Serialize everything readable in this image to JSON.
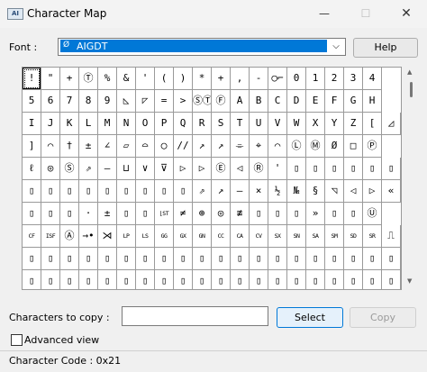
{
  "window": {
    "title": "Character Map",
    "icon": "character-map-app-icon",
    "app_icon_text": "AI",
    "minimize_glyph": "—",
    "maximize_glyph": "☐",
    "close_glyph": "✕"
  },
  "font": {
    "label": "Font :",
    "selected": "AIGDT",
    "icon_glyph": "Ø",
    "dropdown_glyph": "⌵"
  },
  "buttons": {
    "help": "Help",
    "select": "Select",
    "copy": "Copy"
  },
  "copy": {
    "label": "Characters to copy :",
    "value": ""
  },
  "advanced": {
    "label": "Advanced view",
    "checked": false
  },
  "status": {
    "text": "Character Code : 0x21"
  },
  "scrollbar": {
    "up_glyph": "▲",
    "down_glyph": "▼"
  },
  "grid": {
    "selected_index": 0,
    "rows": [
      [
        "!",
        "\"",
        "+",
        "Ⓣ",
        "%",
        "&",
        "'",
        "(",
        ")",
        "*",
        "+",
        ",",
        "-",
        "○⌐",
        "0",
        "1",
        "2",
        "3",
        "4"
      ],
      [
        "5",
        "6",
        "7",
        "8",
        "9",
        "◺",
        "◸",
        "=",
        ">",
        "ⓈⓉ",
        "Ⓕ",
        "A",
        "B",
        "C",
        "D",
        "E",
        "F",
        "G",
        "H"
      ],
      [
        "I",
        "J",
        "K",
        "L",
        "M",
        "N",
        "O",
        "P",
        "Q",
        "R",
        "S",
        "T",
        "U",
        "V",
        "W",
        "X",
        "Y",
        "Z",
        "[",
        "◿"
      ],
      [
        "]",
        "⌒",
        "†",
        "±",
        "∠",
        "▱",
        "⌓",
        "◯",
        "//",
        "↗",
        "↗",
        "⌯",
        "⌖",
        "⌒",
        "Ⓛ",
        "Ⓜ",
        "Ø",
        "□",
        "Ⓟ"
      ],
      [
        "ℓ",
        "◎",
        "Ⓢ",
        "⇗",
        "—",
        "⊔",
        "∨",
        "⊽",
        "▷",
        "▷",
        "Ⓔ",
        "◁",
        "Ⓡ",
        "'",
        "▯",
        "▯",
        "▯",
        "▯",
        "▯",
        "▯"
      ],
      [
        "▯",
        "▯",
        "▯",
        "▯",
        "▯",
        "▯",
        "▯",
        "▯",
        "▯",
        "⇗",
        "↗",
        "—",
        "×",
        "½",
        "№",
        "§",
        "◹",
        "◁",
        "▷",
        "«"
      ],
      [
        "▯",
        "▯",
        "▯",
        "·",
        "±",
        "▯",
        "▯",
        "⌊ST",
        "≠",
        "⊕",
        "◎",
        "≢",
        "▯",
        "▯",
        "▯",
        "»",
        "▯",
        "▯",
        "Ⓤ"
      ],
      [
        "CF",
        "ISF",
        "Ⓐ",
        "→•",
        "⋊",
        "LP",
        "LS",
        "GG",
        "GX",
        "GN",
        "CC",
        "CA",
        "CV",
        "SX",
        "SN",
        "SA",
        "SM",
        "SD",
        "SR",
        "⎍"
      ],
      [
        "▯",
        "▯",
        "▯",
        "▯",
        "▯",
        "▯",
        "▯",
        "▯",
        "▯",
        "▯",
        "▯",
        "▯",
        "▯",
        "▯",
        "▯",
        "▯",
        "▯",
        "▯",
        "▯",
        "▯"
      ],
      [
        "▯",
        "▯",
        "▯",
        "▯",
        "▯",
        "▯",
        "▯",
        "▯",
        "▯",
        "▯",
        "▯",
        "▯",
        "▯",
        "▯",
        "▯",
        "▯",
        "▯",
        "▯",
        "▯",
        "▯"
      ]
    ]
  }
}
